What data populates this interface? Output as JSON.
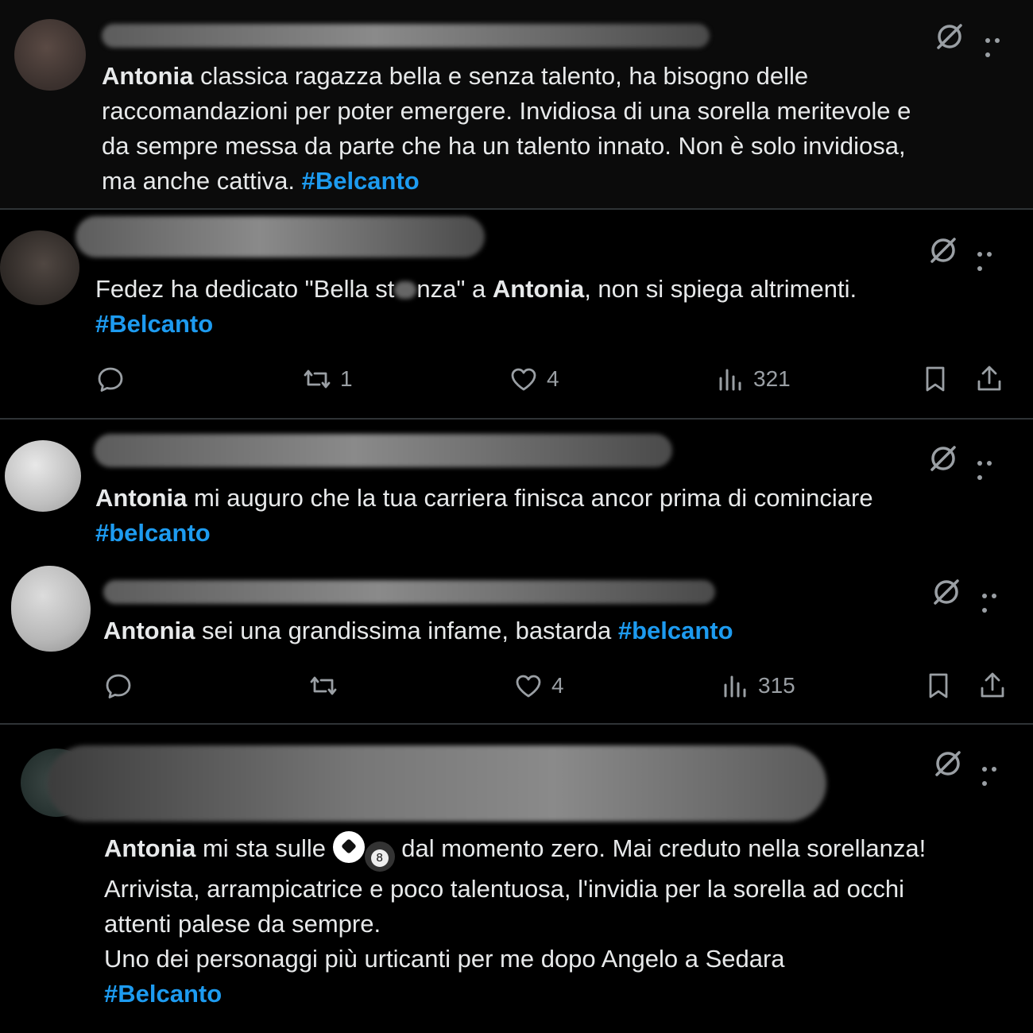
{
  "tweets": [
    {
      "author": "Antonia",
      "text": " classica ragazza bella e senza talento, ha bisogno delle\nraccomandazioni per poter emergere. Invidiosa di una sorella meritevole e\nda sempre messa da parte che ha un talento innato. Non è solo invidiosa,\nma anche cattiva. ",
      "hashtag": "#Belcanto"
    },
    {
      "text_before": "Fedez ha dedicato \"Bella st",
      "text_mid": "nza\" a ",
      "author": "Antonia",
      "text_after": ", non si spiega altrimenti.",
      "hashtag": "#Belcanto",
      "retweets": "1",
      "likes": "4",
      "views": "321"
    },
    {
      "author": "Antonia",
      "text": " mi auguro che la tua carriera finisca ancor prima di cominciare",
      "hashtag": "#belcanto"
    },
    {
      "author": "Antonia",
      "text": " sei una grandissima infame, bastarda ",
      "hashtag": "#belcanto",
      "likes": "4",
      "views": "315"
    },
    {
      "author": "Antonia",
      "text_a": " mi sta sulle ",
      "emoji_eight": "8",
      "text_b": " dal momento zero. Mai creduto nella sorellanza!",
      "line2": "Arrivista, arrampicatrice e poco talentuosa, l'invidia per la sorella ad occhi",
      "line3": "attenti palese da sempre.",
      "line4": "Uno dei personaggi più urticanti per me dopo Angelo a Sedara",
      "hashtag": "#Belcanto"
    }
  ],
  "icons": {
    "grok": "grok-icon",
    "more": "more-icon",
    "reply": "reply-icon",
    "retweet": "retweet-icon",
    "like": "heart-icon",
    "views": "views-icon",
    "bookmark": "bookmark-icon",
    "share": "share-icon"
  },
  "colors": {
    "hashtag": "#1d9bf0",
    "text": "#e7e9ea",
    "muted": "#9a9fa4",
    "background": "#000000"
  }
}
